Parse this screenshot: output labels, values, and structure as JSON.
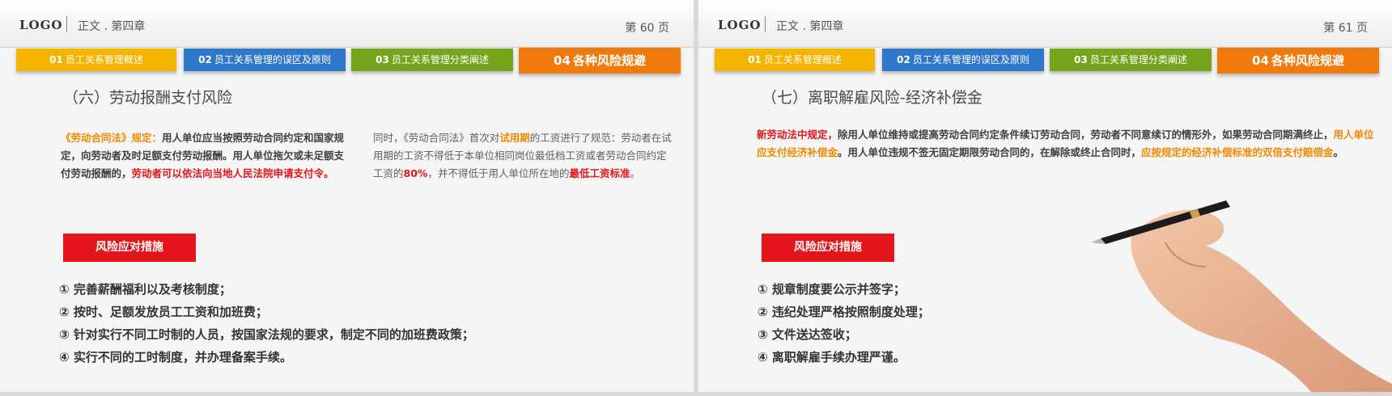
{
  "slides": [
    {
      "logo": "LOGO",
      "chapter": "正文 . 第四章",
      "page": "第 60 页",
      "tabs": [
        {
          "num": "01",
          "label": "员工关系管理概述"
        },
        {
          "num": "02",
          "label": "员工关系管理的误区及原则"
        },
        {
          "num": "03",
          "label": "员工关系管理分类阐述"
        },
        {
          "num": "04",
          "label": "各种风险规避"
        }
      ],
      "title": "（六）劳动报酬支付风险",
      "left_para": {
        "a": "《劳动合同法》规定：",
        "b": "用人单位应当按照劳动合同约定和国家规定，向劳动者及时足额支付劳动报酬。用人单位拖欠或未足额支付劳动报酬的，",
        "c": "劳动者可以依法向当地人民法院申请支付令。"
      },
      "right_para": {
        "a": "同时，《劳动合同法》首次对",
        "b": "试用期",
        "c": "的工资进行了规范：劳动者在试用期的工资不得低于本单位相同岗位最低档工资或者劳动合同约定工资的",
        "d": "80%",
        "e": "，并不得低于用人单位所在地的",
        "f": "最低工资标准",
        "g": "。"
      },
      "risk_label": "风险应对措施",
      "measures": [
        "① 完善薪酬福利以及考核制度；",
        "② 按时、足额发放员工工资和加班费；",
        "③ 针对实行不同工时制的人员，按国家法规的要求，制定不同的加班费政策；",
        "④ 实行不同的工时制度，并办理备案手续。"
      ]
    },
    {
      "logo": "LOGO",
      "chapter": "正文 . 第四章",
      "page": "第 61 页",
      "tabs": [
        {
          "num": "01",
          "label": "员工关系管理概述"
        },
        {
          "num": "02",
          "label": "员工关系管理的误区及原则"
        },
        {
          "num": "03",
          "label": "员工关系管理分类阐述"
        },
        {
          "num": "04",
          "label": "各种风险规避"
        }
      ],
      "title": "（七）离职解雇风险-经济补偿金",
      "para": {
        "a": "新劳动法中规定，",
        "b": "除用人单位维持或提高劳动合同约定条件续订劳动合同，劳动者不同意续订的情形外，如果劳动合同期满终止，",
        "c": "用人单位应支付经济补偿金",
        "d": "。用人单位违规不签无固定期限劳动合同的，在解除或终止合同时，",
        "e": "应按规定的经济补偿标准的双倍支付赔偿金",
        "f": "。"
      },
      "risk_label": "风险应对措施",
      "measures": [
        "① 规章制度要公示并签字；",
        "② 违纪处理严格按照制度处理；",
        "③ 文件送达签收；",
        "④ 离职解雇手续办理严谨。"
      ]
    }
  ],
  "colors": {
    "tab1": "#f5b400",
    "tab2": "#2f77c8",
    "tab3": "#74a51d",
    "tab4": "#f07a0c",
    "red": "#e5161b",
    "orange": "#f08a00"
  }
}
